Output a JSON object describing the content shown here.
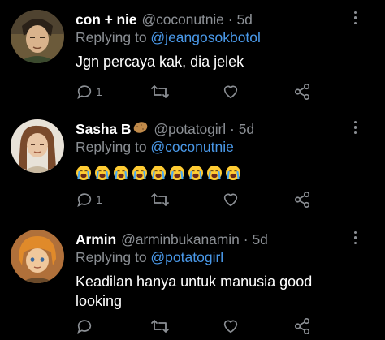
{
  "tweets": [
    {
      "name": "con + nie",
      "handle": "@coconutnie",
      "dot": "·",
      "time": "5d",
      "replying_prefix": "Replying to ",
      "replying_to": "@jeangosokbotol",
      "text": "Jgn percaya kak, dia jelek",
      "reply_count": "1",
      "avatar_icon": "avatar-man-icon"
    },
    {
      "name": "Sasha B",
      "name_emoji": "potato-emoji-icon",
      "handle": "@potatogirl",
      "dot": "·",
      "time": "5d",
      "replying_prefix": "Replying to ",
      "replying_to": "@coconutnie",
      "emoji_row": "crying-face-emoji x9",
      "reply_count": "1",
      "avatar_icon": "avatar-girl-icon"
    },
    {
      "name": "Armin",
      "handle": "@arminbukanamin",
      "dot": "·",
      "time": "5d",
      "replying_prefix": "Replying to ",
      "replying_to": "@potatogirl",
      "text": "Keadilan hanya untuk manusia good looking",
      "reply_count": "",
      "avatar_icon": "avatar-blond-icon"
    }
  ],
  "colors": {
    "background": "#000000",
    "secondary_text": "#8b8f94",
    "mention": "#4a99e9"
  }
}
